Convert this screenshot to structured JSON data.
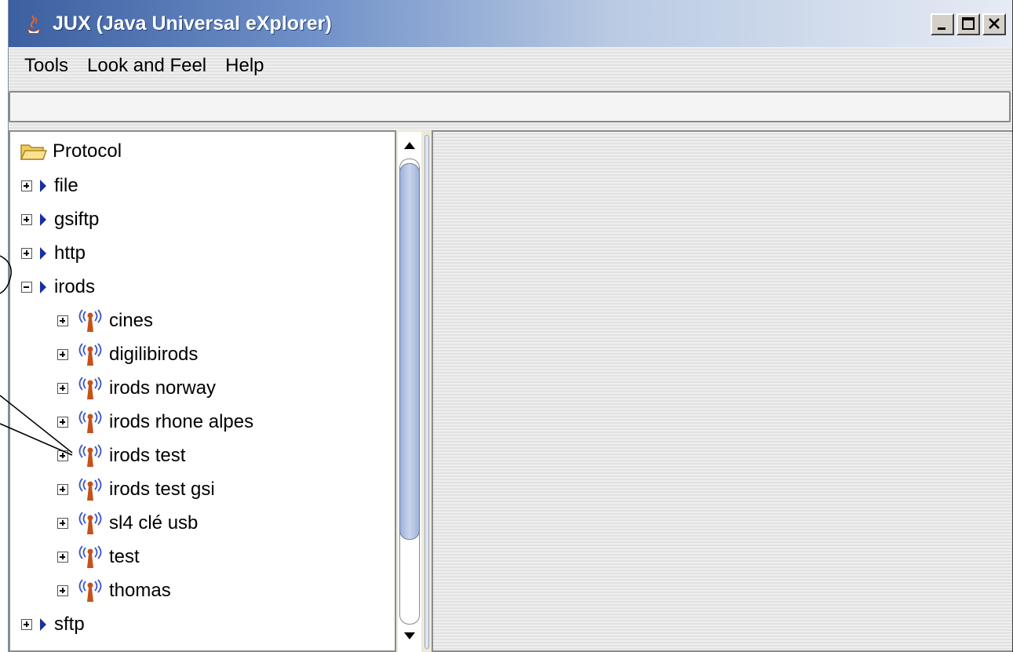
{
  "window": {
    "title": "JUX (Java Universal eXplorer)",
    "icon": "java-coffee-icon",
    "controls": [
      "minimize",
      "maximize",
      "close"
    ]
  },
  "menu": {
    "items": [
      {
        "label": "Tools"
      },
      {
        "label": "Look and Feel"
      },
      {
        "label": "Help"
      }
    ]
  },
  "path_field": {
    "value": ""
  },
  "tree": {
    "root": {
      "label": "Protocol",
      "icon": "folder-open-icon"
    },
    "rows": [
      {
        "label": "file",
        "expanded": false,
        "icon": "triangle-icon",
        "level": 1
      },
      {
        "label": "gsiftp",
        "expanded": false,
        "icon": "triangle-icon",
        "level": 1
      },
      {
        "label": "http",
        "expanded": false,
        "icon": "triangle-icon",
        "level": 1
      },
      {
        "label": "irods",
        "expanded": true,
        "icon": "triangle-icon",
        "level": 1
      },
      {
        "label": "cines",
        "expanded": false,
        "icon": "antenna-icon",
        "level": 2
      },
      {
        "label": "digilibirods",
        "expanded": false,
        "icon": "antenna-icon",
        "level": 2
      },
      {
        "label": "irods norway",
        "expanded": false,
        "icon": "antenna-icon",
        "level": 2
      },
      {
        "label": "irods rhone alpes",
        "expanded": false,
        "icon": "antenna-icon",
        "level": 2
      },
      {
        "label": "irods test",
        "expanded": false,
        "icon": "antenna-icon",
        "level": 2
      },
      {
        "label": "irods test gsi",
        "expanded": false,
        "icon": "antenna-icon",
        "level": 2
      },
      {
        "label": "sl4 clé usb",
        "expanded": false,
        "icon": "antenna-icon",
        "level": 2
      },
      {
        "label": "test",
        "expanded": false,
        "icon": "antenna-icon",
        "level": 2
      },
      {
        "label": "thomas",
        "expanded": false,
        "icon": "antenna-icon",
        "level": 2
      },
      {
        "label": "sftp",
        "expanded": false,
        "icon": "triangle-icon",
        "level": 1
      }
    ]
  },
  "colors": {
    "titlebar_start": "#3b5fa0",
    "tree_triangle": "#1a2ea5",
    "antenna_mast": "#c4521a",
    "antenna_waves": "#3a55c8"
  }
}
